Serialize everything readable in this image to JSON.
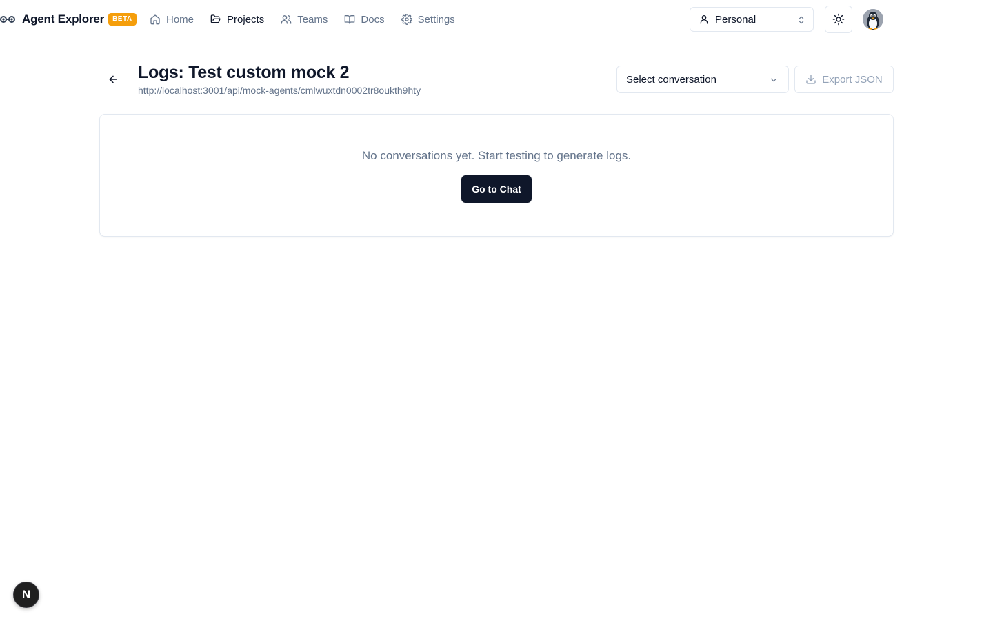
{
  "brand": {
    "name": "Agent Explorer",
    "badge": "BETA"
  },
  "nav": {
    "items": [
      {
        "label": "Home",
        "icon": "home-icon",
        "active": false
      },
      {
        "label": "Projects",
        "icon": "folder-open-icon",
        "active": true
      },
      {
        "label": "Teams",
        "icon": "users-icon",
        "active": false
      },
      {
        "label": "Docs",
        "icon": "book-icon",
        "active": false
      },
      {
        "label": "Settings",
        "icon": "gear-icon",
        "active": false
      }
    ]
  },
  "workspace": {
    "label": "Personal"
  },
  "header": {
    "title": "Logs: Test custom mock 2",
    "url": "http://localhost:3001/api/mock-agents/cmlwuxtdn0002tr8oukth9hty",
    "select_label": "Select conversation",
    "export_label": "Export JSON"
  },
  "empty_state": {
    "message": "No conversations yet. Start testing to generate logs.",
    "button_label": "Go to Chat"
  },
  "dev_badge": {
    "letter": "N"
  },
  "colors": {
    "primary": "#0f172a",
    "muted": "#64748b",
    "border": "#e2e8f0",
    "beta": "#f59e0b"
  }
}
